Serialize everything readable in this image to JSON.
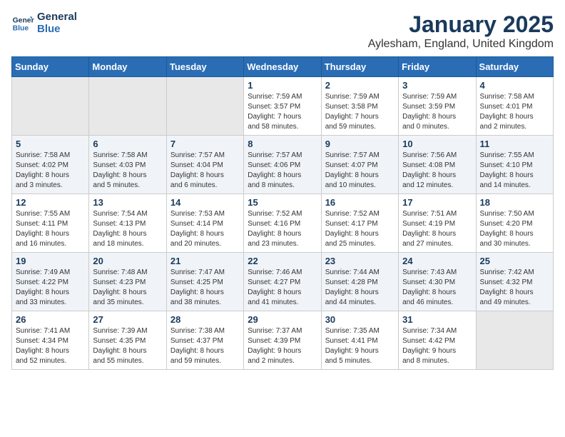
{
  "logo": {
    "line1": "General",
    "line2": "Blue"
  },
  "title": "January 2025",
  "subtitle": "Aylesham, England, United Kingdom",
  "weekdays": [
    "Sunday",
    "Monday",
    "Tuesday",
    "Wednesday",
    "Thursday",
    "Friday",
    "Saturday"
  ],
  "weeks": [
    [
      {
        "day": "",
        "info": ""
      },
      {
        "day": "",
        "info": ""
      },
      {
        "day": "",
        "info": ""
      },
      {
        "day": "1",
        "info": "Sunrise: 7:59 AM\nSunset: 3:57 PM\nDaylight: 7 hours\nand 58 minutes."
      },
      {
        "day": "2",
        "info": "Sunrise: 7:59 AM\nSunset: 3:58 PM\nDaylight: 7 hours\nand 59 minutes."
      },
      {
        "day": "3",
        "info": "Sunrise: 7:59 AM\nSunset: 3:59 PM\nDaylight: 8 hours\nand 0 minutes."
      },
      {
        "day": "4",
        "info": "Sunrise: 7:58 AM\nSunset: 4:01 PM\nDaylight: 8 hours\nand 2 minutes."
      }
    ],
    [
      {
        "day": "5",
        "info": "Sunrise: 7:58 AM\nSunset: 4:02 PM\nDaylight: 8 hours\nand 3 minutes."
      },
      {
        "day": "6",
        "info": "Sunrise: 7:58 AM\nSunset: 4:03 PM\nDaylight: 8 hours\nand 5 minutes."
      },
      {
        "day": "7",
        "info": "Sunrise: 7:57 AM\nSunset: 4:04 PM\nDaylight: 8 hours\nand 6 minutes."
      },
      {
        "day": "8",
        "info": "Sunrise: 7:57 AM\nSunset: 4:06 PM\nDaylight: 8 hours\nand 8 minutes."
      },
      {
        "day": "9",
        "info": "Sunrise: 7:57 AM\nSunset: 4:07 PM\nDaylight: 8 hours\nand 10 minutes."
      },
      {
        "day": "10",
        "info": "Sunrise: 7:56 AM\nSunset: 4:08 PM\nDaylight: 8 hours\nand 12 minutes."
      },
      {
        "day": "11",
        "info": "Sunrise: 7:55 AM\nSunset: 4:10 PM\nDaylight: 8 hours\nand 14 minutes."
      }
    ],
    [
      {
        "day": "12",
        "info": "Sunrise: 7:55 AM\nSunset: 4:11 PM\nDaylight: 8 hours\nand 16 minutes."
      },
      {
        "day": "13",
        "info": "Sunrise: 7:54 AM\nSunset: 4:13 PM\nDaylight: 8 hours\nand 18 minutes."
      },
      {
        "day": "14",
        "info": "Sunrise: 7:53 AM\nSunset: 4:14 PM\nDaylight: 8 hours\nand 20 minutes."
      },
      {
        "day": "15",
        "info": "Sunrise: 7:52 AM\nSunset: 4:16 PM\nDaylight: 8 hours\nand 23 minutes."
      },
      {
        "day": "16",
        "info": "Sunrise: 7:52 AM\nSunset: 4:17 PM\nDaylight: 8 hours\nand 25 minutes."
      },
      {
        "day": "17",
        "info": "Sunrise: 7:51 AM\nSunset: 4:19 PM\nDaylight: 8 hours\nand 27 minutes."
      },
      {
        "day": "18",
        "info": "Sunrise: 7:50 AM\nSunset: 4:20 PM\nDaylight: 8 hours\nand 30 minutes."
      }
    ],
    [
      {
        "day": "19",
        "info": "Sunrise: 7:49 AM\nSunset: 4:22 PM\nDaylight: 8 hours\nand 33 minutes."
      },
      {
        "day": "20",
        "info": "Sunrise: 7:48 AM\nSunset: 4:23 PM\nDaylight: 8 hours\nand 35 minutes."
      },
      {
        "day": "21",
        "info": "Sunrise: 7:47 AM\nSunset: 4:25 PM\nDaylight: 8 hours\nand 38 minutes."
      },
      {
        "day": "22",
        "info": "Sunrise: 7:46 AM\nSunset: 4:27 PM\nDaylight: 8 hours\nand 41 minutes."
      },
      {
        "day": "23",
        "info": "Sunrise: 7:44 AM\nSunset: 4:28 PM\nDaylight: 8 hours\nand 44 minutes."
      },
      {
        "day": "24",
        "info": "Sunrise: 7:43 AM\nSunset: 4:30 PM\nDaylight: 8 hours\nand 46 minutes."
      },
      {
        "day": "25",
        "info": "Sunrise: 7:42 AM\nSunset: 4:32 PM\nDaylight: 8 hours\nand 49 minutes."
      }
    ],
    [
      {
        "day": "26",
        "info": "Sunrise: 7:41 AM\nSunset: 4:34 PM\nDaylight: 8 hours\nand 52 minutes."
      },
      {
        "day": "27",
        "info": "Sunrise: 7:39 AM\nSunset: 4:35 PM\nDaylight: 8 hours\nand 55 minutes."
      },
      {
        "day": "28",
        "info": "Sunrise: 7:38 AM\nSunset: 4:37 PM\nDaylight: 8 hours\nand 59 minutes."
      },
      {
        "day": "29",
        "info": "Sunrise: 7:37 AM\nSunset: 4:39 PM\nDaylight: 9 hours\nand 2 minutes."
      },
      {
        "day": "30",
        "info": "Sunrise: 7:35 AM\nSunset: 4:41 PM\nDaylight: 9 hours\nand 5 minutes."
      },
      {
        "day": "31",
        "info": "Sunrise: 7:34 AM\nSunset: 4:42 PM\nDaylight: 9 hours\nand 8 minutes."
      },
      {
        "day": "",
        "info": ""
      }
    ]
  ]
}
